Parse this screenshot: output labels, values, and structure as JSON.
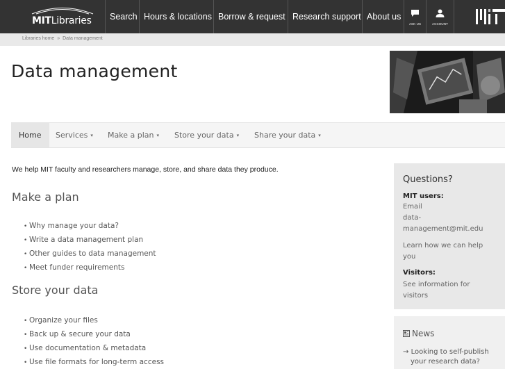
{
  "header": {
    "logo_bold": "MIT",
    "logo_rest": "Libraries",
    "nav": [
      "Search",
      "Hours & locations",
      "Borrow & request",
      "Research support",
      "About us"
    ],
    "ask_us_label": "ASK US",
    "account_label": "ACCOUNT",
    "background_color": "#333333"
  },
  "breadcrumb": {
    "home": "Libraries home",
    "separator": "»",
    "current": "Data management"
  },
  "page": {
    "title": "Data management"
  },
  "subnav": {
    "items": [
      {
        "label": "Home",
        "caret": ""
      },
      {
        "label": "Services",
        "caret": "▾"
      },
      {
        "label": "Make a plan",
        "caret": "▾"
      },
      {
        "label": "Store your data",
        "caret": "▾"
      },
      {
        "label": "Share your data",
        "caret": "▾"
      }
    ]
  },
  "main": {
    "intro": "We help MIT faculty and researchers manage, store, and share data they produce.",
    "sections": [
      {
        "heading": "Make a plan",
        "items": [
          "Why manage your data?",
          "Write a data management plan",
          "Other guides to data management",
          "Meet funder requirements"
        ]
      },
      {
        "heading": "Store your data",
        "items": [
          "Organize your files",
          "Back up & secure your data",
          "Use documentation & metadata",
          "Use file formats for long-term access"
        ]
      }
    ]
  },
  "sidebar": {
    "title": "Questions?",
    "mit_users_label": "MIT users:",
    "email_lines": [
      "Email",
      "data-",
      "management@mit.edu"
    ],
    "learn_lines": [
      "Learn how we can help",
      "you"
    ],
    "visitors_label": "Visitors:",
    "visitors_lines": [
      "See information for",
      "visitors"
    ]
  },
  "news": {
    "title": "News",
    "items": [
      {
        "lines": [
          "Looking to self-publish",
          "your research data?"
        ]
      }
    ]
  }
}
